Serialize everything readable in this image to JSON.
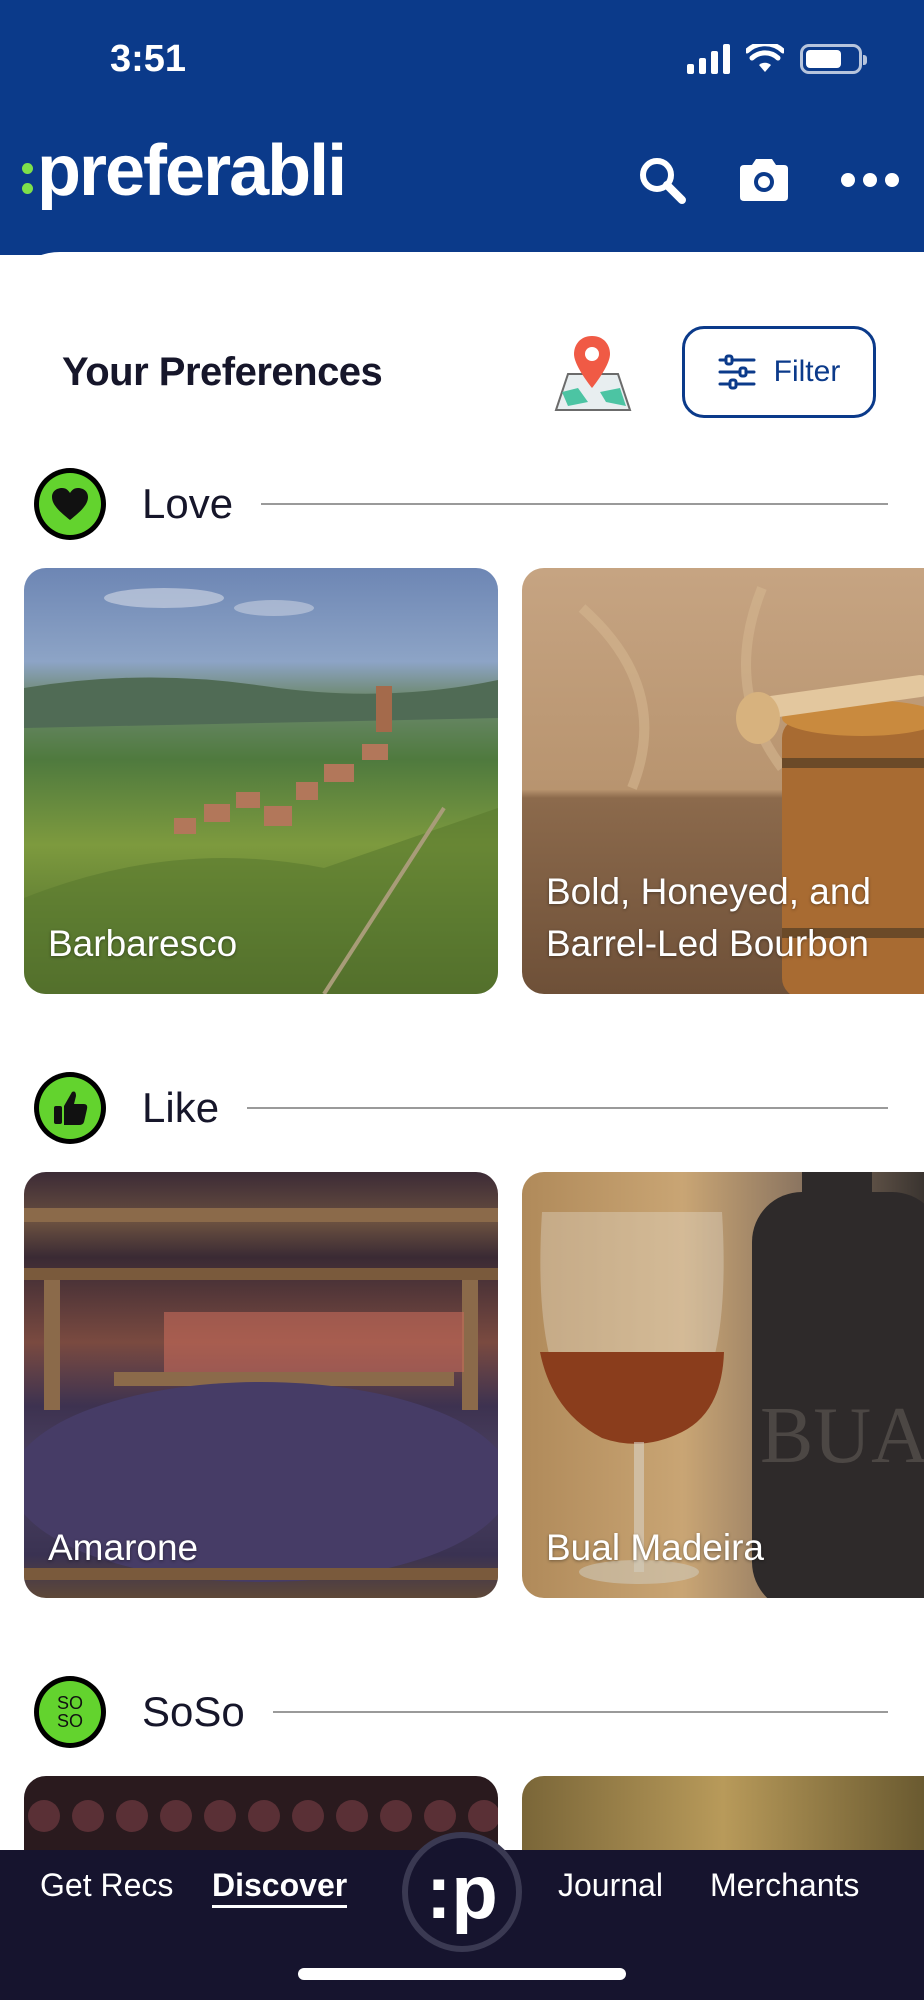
{
  "status_bar": {
    "time": "3:51"
  },
  "header": {
    "logo_text": "preferabli",
    "icons": [
      "search-icon",
      "camera-icon",
      "more-icon"
    ]
  },
  "preferences": {
    "title": "Your Preferences",
    "filter_label": "Filter"
  },
  "sections": [
    {
      "label": "Love",
      "badge_icon": "heart-icon",
      "cards": [
        {
          "label": "Barbaresco"
        },
        {
          "label": "Bold, Honeyed, and Barrel-Led Bourbon"
        }
      ]
    },
    {
      "label": "Like",
      "badge_icon": "thumbs-up-icon",
      "cards": [
        {
          "label": "Amarone"
        },
        {
          "label": "Bual Madeira"
        }
      ]
    },
    {
      "label": "SoSo",
      "badge_icon": "soso-icon",
      "badge_text": "SO SO"
    }
  ],
  "bottom_nav": {
    "items": [
      {
        "label": "Get Recs"
      },
      {
        "label": "Discover"
      },
      {
        "label": "Journal"
      },
      {
        "label": "Merchants"
      }
    ],
    "center_logo": ":p"
  },
  "colors": {
    "brand_blue": "#0b3a8a",
    "accent_green": "#63d32e",
    "nav_dark": "#16142e"
  }
}
